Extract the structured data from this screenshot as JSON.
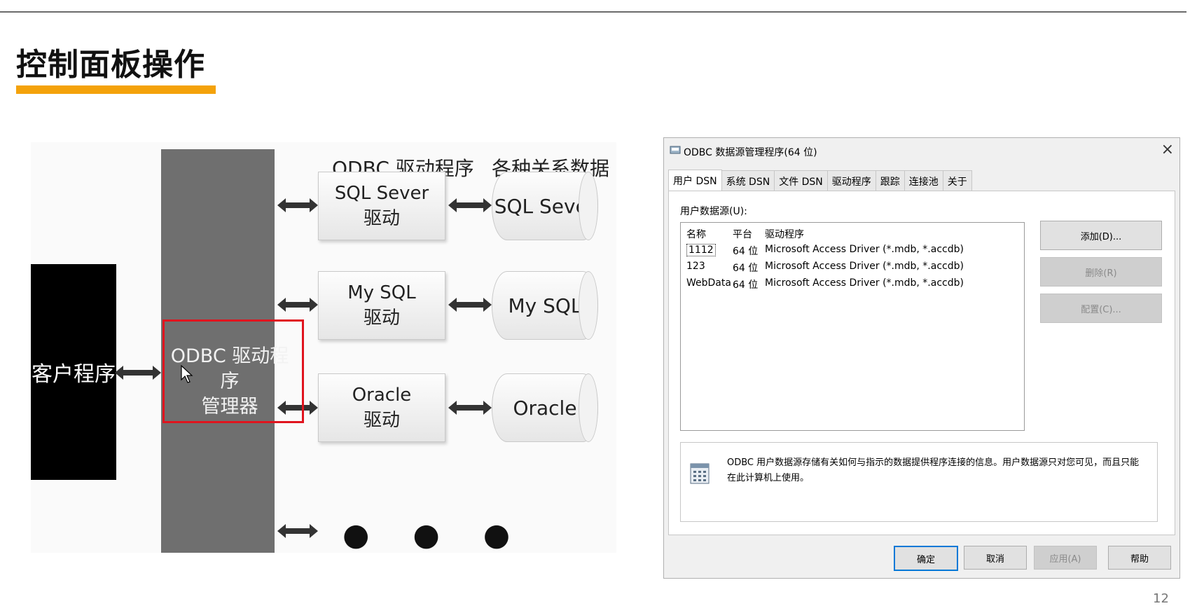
{
  "slide": {
    "title": "控制面板操作",
    "page_number": "12",
    "accent_color": "#f4a20b"
  },
  "diagram": {
    "client_label": "客户程序",
    "manager_label_line1": "ODBC 驱动程序",
    "manager_label_line2": "管理器",
    "header_drivers": "ODBC 驱动程序",
    "header_databases": "各种关系数据库",
    "drivers": [
      {
        "name": "SQL Sever",
        "sub": "驱动"
      },
      {
        "name": "My SQL",
        "sub": "驱动"
      },
      {
        "name": "Oracle",
        "sub": "驱动"
      }
    ],
    "databases": [
      "SQL Sever",
      "My SQL",
      "Oracle"
    ],
    "ellipsis": "● ● ●",
    "highlight_color": "#e0141e"
  },
  "dialog": {
    "title": "ODBC 数据源管理程序(64 位)",
    "close_glyph": "×",
    "tabs": [
      "用户 DSN",
      "系统 DSN",
      "文件 DSN",
      "驱动程序",
      "跟踪",
      "连接池",
      "关于"
    ],
    "active_tab": "用户 DSN",
    "list_label": "用户数据源(U):",
    "columns": [
      "名称",
      "平台",
      "驱动程序"
    ],
    "rows": [
      {
        "name": "1112",
        "platform": "64 位",
        "driver": "Microsoft Access Driver (*.mdb, *.accdb)"
      },
      {
        "name": "123",
        "platform": "64 位",
        "driver": "Microsoft Access Driver (*.mdb, *.accdb)"
      },
      {
        "name": "WebData",
        "platform": "64 位",
        "driver": "Microsoft Access Driver (*.mdb, *.accdb)"
      }
    ],
    "side_buttons": {
      "add": "添加(D)...",
      "remove": "删除(R)",
      "configure": "配置(C)..."
    },
    "info_text": "ODBC 用户数据源存储有关如何与指示的数据提供程序连接的信息。用户数据源只对您可见，而且只能在此计算机上使用。",
    "footer_buttons": {
      "ok": "确定",
      "cancel": "取消",
      "apply": "应用(A)",
      "help": "帮助"
    }
  }
}
